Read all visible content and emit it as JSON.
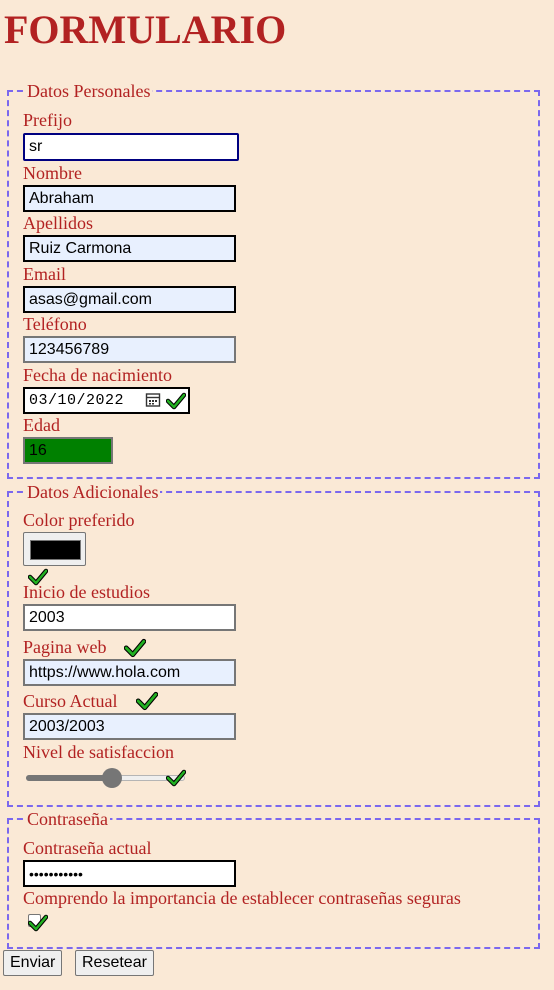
{
  "title": "FORMULARIO",
  "personal": {
    "legend": "Datos Personales",
    "prefix": {
      "label": "Prefijo",
      "value": "sr"
    },
    "name": {
      "label": "Nombre",
      "value": "Abraham"
    },
    "surname": {
      "label": "Apellidos",
      "value": "Ruiz Carmona"
    },
    "email": {
      "label": "Email",
      "value": "asas@gmail.com"
    },
    "phone": {
      "label": "Teléfono",
      "value": "123456789"
    },
    "birth": {
      "label": "Fecha de nacimiento",
      "value": "03/10/2022"
    },
    "age": {
      "label": "Edad",
      "value": "16"
    }
  },
  "additional": {
    "legend": "Datos Adicionales",
    "color": {
      "label": "Color preferido",
      "value": "#000000"
    },
    "study_start": {
      "label": "Inicio de estudios",
      "value": "2003"
    },
    "website": {
      "label": "Pagina web",
      "value": "https://www.hola.com"
    },
    "course": {
      "label": "Curso Actual",
      "value": "2003/2003"
    },
    "satisfaction": {
      "label": "Nivel de satisfaccion",
      "level": 0.55
    }
  },
  "password": {
    "legend": "Contraseña",
    "current": {
      "label": "Contraseña actual",
      "value": "•••••••••••"
    },
    "agree": {
      "label": "Comprendo la importancia de establecer contraseñas seguras",
      "checked": true
    }
  },
  "buttons": {
    "submit": "Enviar",
    "reset": "Resetear"
  },
  "colors": {
    "accent": "#b22222",
    "border": "#7b68ee",
    "background": "#fae9d6",
    "age_bg": "#008000",
    "check": "#00b000"
  }
}
